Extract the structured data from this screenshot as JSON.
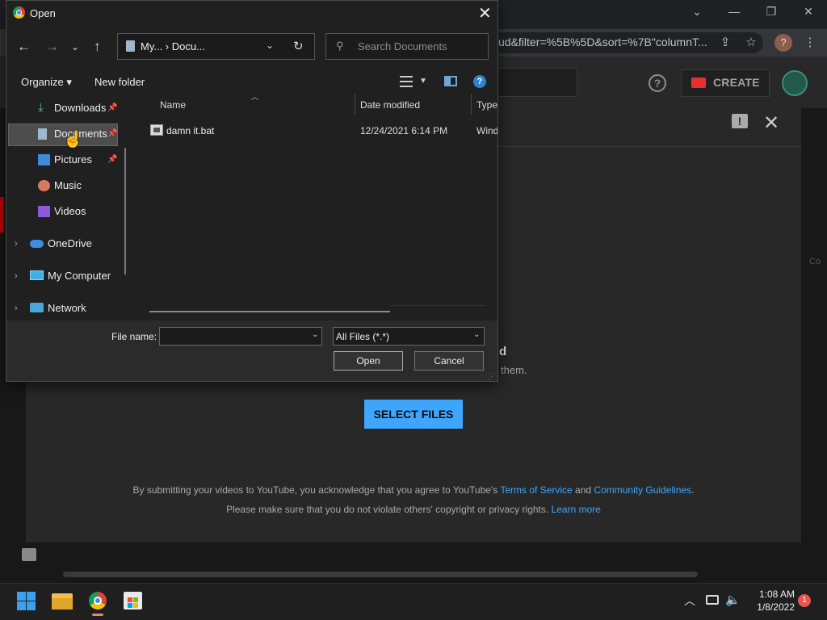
{
  "browser": {
    "url_fragment": "ud&filter=%5B%5D&sort=%7B\"columnT...",
    "profile_initial": "?",
    "create_label": "CREATE",
    "right_cut_text": "Co"
  },
  "upload_modal": {
    "drag_title": "d",
    "drag_sub": "them.",
    "select_files_label": "SELECT FILES",
    "legal_line1_pre": "By submitting your videos to YouTube, you acknowledge that you agree to YouTube's ",
    "terms_link": "Terms of Service",
    "legal_and": " and ",
    "guidelines_link": "Community Guidelines",
    "legal_period": ".",
    "legal_line2_pre": "Please make sure that you do not violate others' copyright or privacy rights. ",
    "learn_more_link": "Learn more"
  },
  "dialog": {
    "title": "Open",
    "address": "My...  ›  Docu...",
    "address_lead": "›",
    "search_placeholder": "Search Documents",
    "organize_label": "Organize ▾",
    "new_folder_label": "New folder",
    "help_glyph": "?",
    "nav_items": [
      {
        "label": "Downloads",
        "icon": "download-icon"
      },
      {
        "label": "Documents",
        "icon": "documents-icon"
      },
      {
        "label": "Pictures",
        "icon": "pictures-icon"
      },
      {
        "label": "Music",
        "icon": "music-icon"
      },
      {
        "label": "Videos",
        "icon": "videos-icon"
      },
      {
        "label": "OneDrive",
        "icon": "cloud-icon"
      },
      {
        "label": "My Computer",
        "icon": "computer-icon"
      },
      {
        "label": "Network",
        "icon": "network-icon"
      }
    ],
    "columns": {
      "name": "Name",
      "date": "Date modified",
      "type": "Type"
    },
    "files": [
      {
        "name": "damn it.bat",
        "date": "12/24/2021 6:14 PM",
        "type": "Wind"
      }
    ],
    "file_name_label": "File name:",
    "file_name_value": "",
    "filter_value": "All Files (*.*)",
    "open_label": "Open",
    "cancel_label": "Cancel"
  },
  "taskbar": {
    "time": "1:08 AM",
    "date": "1/8/2022",
    "notifications": "1"
  }
}
